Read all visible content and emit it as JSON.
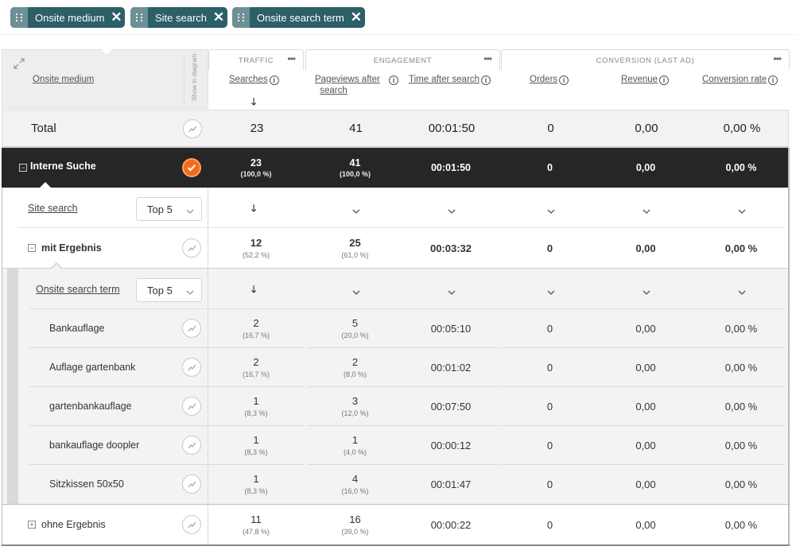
{
  "chips": [
    {
      "label": "Onsite medium"
    },
    {
      "label": "Site search"
    },
    {
      "label": "Onsite search term"
    }
  ],
  "header": {
    "medium_col": "Onsite medium",
    "show_in_diagram": "Show in diagram",
    "groups": [
      {
        "title": "TRAFFIC"
      },
      {
        "title": "ENGAGEMENT"
      },
      {
        "title": "CONVERSION (LAST AD)"
      }
    ],
    "columns": {
      "searches": "Searches",
      "pageviews_line1": "Pageviews after",
      "pageviews_line2": "search",
      "time": "Time after search",
      "orders": "Orders",
      "revenue": "Revenue",
      "conversion": "Conversion rate"
    },
    "info_glyph": "i",
    "sort_glyph": "🡓"
  },
  "total": {
    "label": "Total",
    "searches": "23",
    "pageviews": "41",
    "time": "00:01:50",
    "orders": "0",
    "revenue": "0,00",
    "conversion": "0,00 %"
  },
  "interne": {
    "label": "Interne Suche",
    "searches": "23",
    "searches_pct": "(100,0 %)",
    "pageviews": "41",
    "pageviews_pct": "(100,0 %)",
    "time": "00:01:50",
    "orders": "0",
    "revenue": "0,00",
    "conversion": "0,00 %"
  },
  "site_search_row": {
    "label": "Site search",
    "selector": "Top 5"
  },
  "mit": {
    "label": "mit Ergebnis",
    "searches": "12",
    "searches_pct": "(52,2 %)",
    "pageviews": "25",
    "pageviews_pct": "(61,0 %)",
    "time": "00:03:32",
    "orders": "0",
    "revenue": "0,00",
    "conversion": "0,00 %"
  },
  "term_row": {
    "label": "Onsite search term",
    "selector": "Top 5"
  },
  "terms": [
    {
      "label": "Bankauflage",
      "searches": "2",
      "searches_pct": "(16,7 %)",
      "pageviews": "5",
      "pageviews_pct": "(20,0 %)",
      "time": "00:05:10",
      "orders": "0",
      "revenue": "0,00",
      "conversion": "0,00 %"
    },
    {
      "label": "Auflage gartenbank",
      "searches": "2",
      "searches_pct": "(16,7 %)",
      "pageviews": "2",
      "pageviews_pct": "(8,0 %)",
      "time": "00:01:02",
      "orders": "0",
      "revenue": "0,00",
      "conversion": "0,00 %"
    },
    {
      "label": "gartenbankauflage",
      "searches": "1",
      "searches_pct": "(8,3 %)",
      "pageviews": "3",
      "pageviews_pct": "(12,0 %)",
      "time": "00:07:50",
      "orders": "0",
      "revenue": "0,00",
      "conversion": "0,00 %"
    },
    {
      "label": "bankauflage doopler",
      "searches": "1",
      "searches_pct": "(8,3 %)",
      "pageviews": "1",
      "pageviews_pct": "(4,0 %)",
      "time": "00:00:12",
      "orders": "0",
      "revenue": "0,00",
      "conversion": "0,00 %"
    },
    {
      "label": "Sitzkissen 50x50",
      "searches": "1",
      "searches_pct": "(8,3 %)",
      "pageviews": "4",
      "pageviews_pct": "(16,0 %)",
      "time": "00:01:47",
      "orders": "0",
      "revenue": "0,00",
      "conversion": "0,00 %"
    }
  ],
  "ohne": {
    "label": "ohne Ergebnis",
    "searches": "11",
    "searches_pct": "(47,8 %)",
    "pageviews": "16",
    "pageviews_pct": "(39,0 %)",
    "time": "00:00:22",
    "orders": "0",
    "revenue": "0,00",
    "conversion": "0,00 %"
  },
  "colors": {
    "chip_bg": "#2d5f69",
    "chip_grip": "#6d8f96",
    "selected_row_bg": "#262626",
    "accent_orange": "#f26b1d"
  },
  "icons": [
    "drag-handle-icon",
    "close-icon",
    "expand-icon",
    "info-icon",
    "sort-down-icon",
    "chevron-down-icon",
    "trend-icon",
    "check-icon",
    "collapse-icon",
    "expand-row-icon",
    "more-icon"
  ]
}
